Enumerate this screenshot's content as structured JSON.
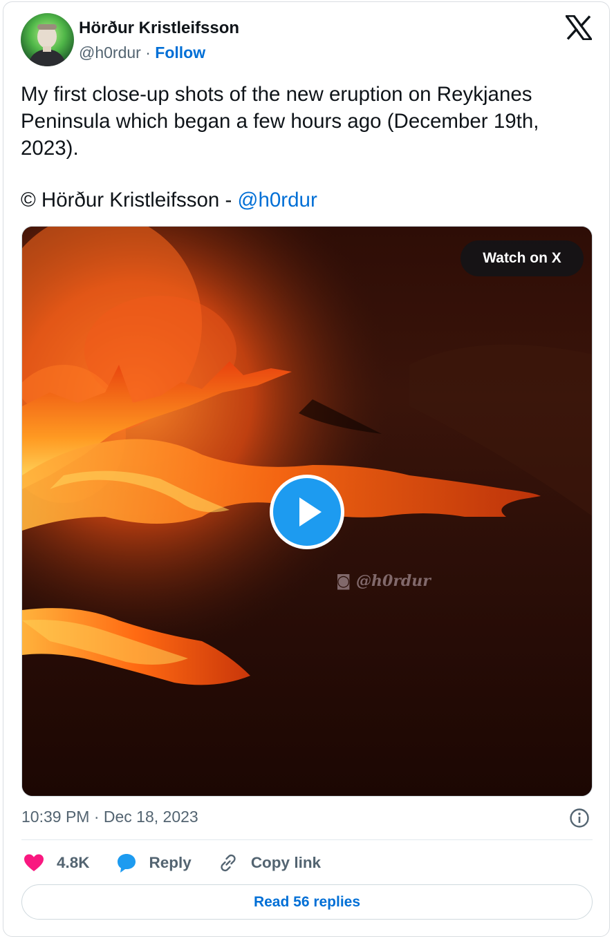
{
  "author": {
    "name": "Hörður Kristleifsson",
    "handle": "@h0rdur",
    "separator": "·",
    "follow_label": "Follow",
    "avatar_icon": "profile-photo"
  },
  "brand": {
    "logo_icon": "x-logo-icon",
    "link_color": "#006fd6",
    "muted_color": "#536471",
    "like_color": "#f91880",
    "reply_color": "#1d9bf0"
  },
  "tweet": {
    "text": "My first close-up shots of the new eruption on Reykjanes Peninsula which began a few hours ago (December 19th, 2023).",
    "credit_prefix": "© Hörður Kristleifsson - ",
    "credit_mention": "@h0rdur"
  },
  "media": {
    "watch_label": "Watch on X",
    "watermark": "@h0rdur",
    "play_icon": "play-icon"
  },
  "meta": {
    "timestamp": "10:39 PM · Dec 18, 2023",
    "info_icon": "info-icon"
  },
  "actions": {
    "likes_count": "4.8K",
    "like_icon": "heart-icon",
    "reply_label": "Reply",
    "reply_icon": "speech-bubble-icon",
    "copy_label": "Copy link",
    "copy_icon": "link-icon"
  },
  "replies": {
    "label": "Read 56 replies"
  }
}
